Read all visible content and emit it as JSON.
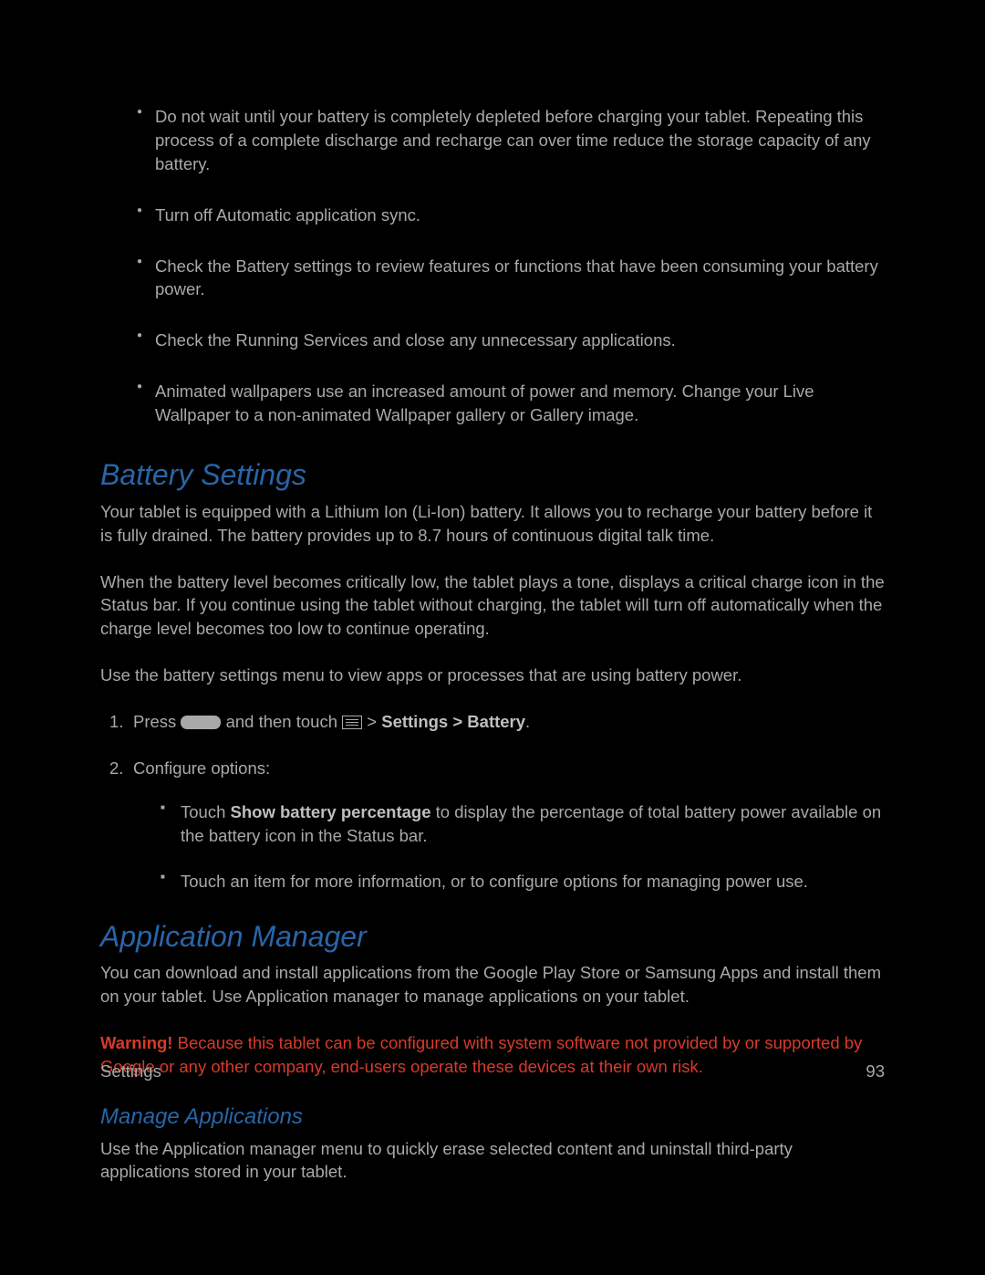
{
  "tips": [
    "Do not wait until your battery is completely depleted before charging your tablet. Repeating this process of a complete discharge and recharge can over time reduce the storage capacity of any battery.",
    "Turn off Automatic application sync.",
    "Check the Battery settings to review features or functions that have been consuming your battery power.",
    "Check the Running Services and close any unnecessary applications.",
    "Animated wallpapers use an increased amount of power and memory. Change your Live Wallpaper to a non-animated Wallpaper gallery or Gallery image."
  ],
  "battery": {
    "heading": "Battery Settings",
    "p1": "Your tablet is equipped with a Lithium Ion (Li-Ion) battery. It allows you to recharge your battery before it is fully drained. The battery provides up to 8.7 hours of continuous digital talk time.",
    "p2": "When the battery level becomes critically low, the tablet plays a tone, displays a critical charge icon in the Status bar. If you continue using the tablet without charging, the tablet will turn off automatically when the charge level becomes too low to continue operating.",
    "p3": "Use the battery settings menu to view apps or processes that are using battery power.",
    "step1_a": "Press ",
    "step1_b": " and then touch ",
    "step1_c": " > ",
    "step1_bold": "Settings > Battery",
    "step1_d": ".",
    "step2": "Configure options:",
    "sub1_a": "Touch ",
    "sub1_bold": "Show battery percentage",
    "sub1_b": " to display the percentage of total battery power available on the battery icon in the Status bar.",
    "sub2": "Touch an item for more information, or to configure options for managing power use."
  },
  "appmgr": {
    "heading": "Application Manager",
    "p1": "You can download and install applications from the Google Play Store or Samsung Apps and install them on your tablet. Use Application manager to manage applications on your tablet.",
    "warn_label": "Warning!",
    "warn_text": " Because this tablet can be configured with system software not provided by or supported by Google or any other company, end-users operate these devices at their own risk.",
    "sub_heading": "Manage Applications",
    "p2": "Use the Application manager menu to quickly erase selected content and uninstall third-party applications stored in your tablet."
  },
  "footer": {
    "left": "Settings",
    "right": "93"
  }
}
